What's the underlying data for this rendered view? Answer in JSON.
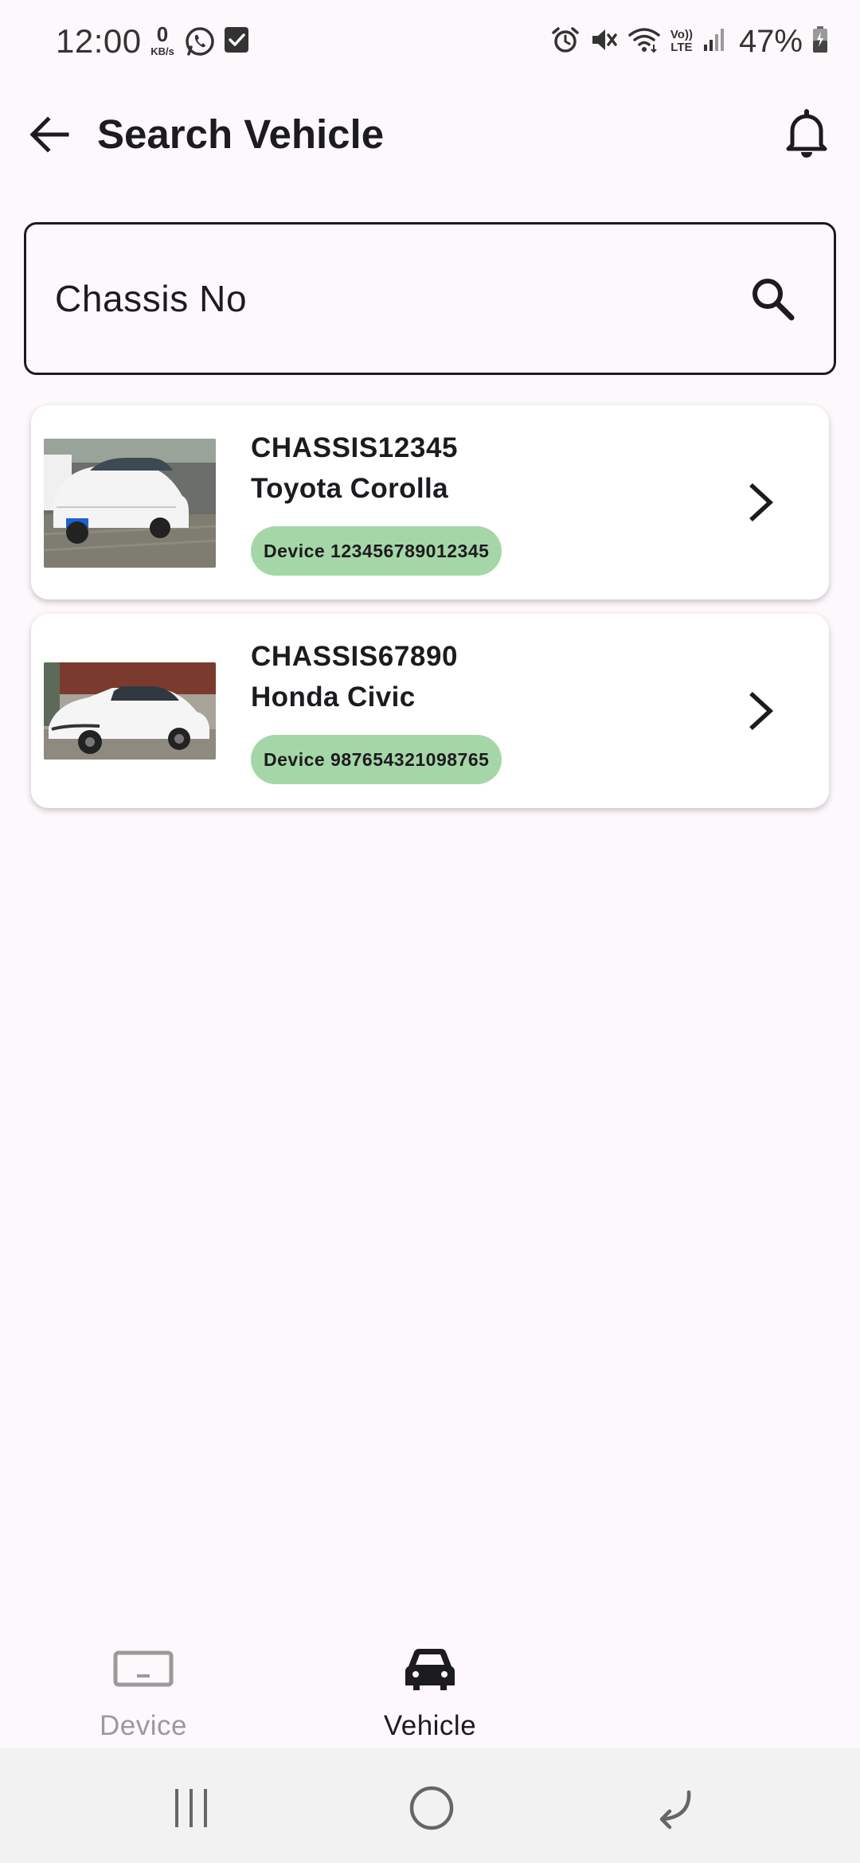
{
  "status_bar": {
    "time": "12:00",
    "net_speed_value": "0",
    "net_speed_unit": "KB/s",
    "left_icons": [
      "whatsapp-icon",
      "checkbox-notification-icon"
    ],
    "right_icons": [
      "alarm-icon",
      "mute-icon",
      "wifi-icon",
      "volte-lte-icon",
      "signal-icon",
      "battery-icon"
    ],
    "volte_label_top": "Vo))",
    "volte_label_bottom": "LTE",
    "battery_percent": "47%"
  },
  "app_bar": {
    "title": "Search Vehicle",
    "back_icon": "arrow-left-icon",
    "notification_icon": "bell-icon"
  },
  "search": {
    "placeholder": "Chassis No",
    "icon": "search-icon"
  },
  "vehicles": [
    {
      "chassis": "CHASSIS12345",
      "model": "Toyota Corolla",
      "device": "Device 123456789012345",
      "photo_color": "white"
    },
    {
      "chassis": "CHASSIS67890",
      "model": "Honda Civic",
      "device": "Device 987654321098765",
      "photo_color": "white"
    }
  ],
  "bottom_nav": {
    "items": [
      {
        "label": "Device",
        "icon": "device-icon",
        "active": false
      },
      {
        "label": "Vehicle",
        "icon": "car-icon",
        "active": true
      }
    ]
  },
  "colors": {
    "background": "#fdf8fc",
    "badge": "#a5d6a7",
    "text_primary": "#1c1b1f",
    "inactive_nav": "#9a9a9a",
    "system_nav_bg": "#f2f2f2"
  },
  "system_nav": [
    "recents-icon",
    "home-icon",
    "back-icon"
  ]
}
